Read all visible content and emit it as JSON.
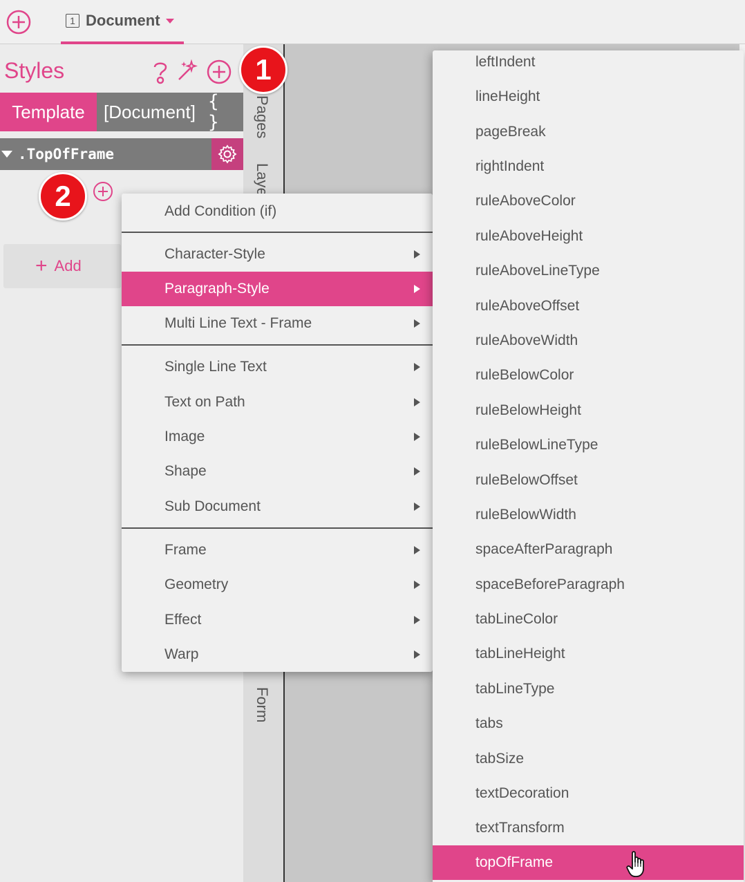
{
  "tabbar": {
    "new_icon": "plus-circle-icon",
    "document_tab": {
      "number": "1",
      "label": "Document"
    }
  },
  "styles_panel": {
    "title": "Styles",
    "header_icons": [
      "question-icon",
      "magic-wand-icon",
      "plus-circle-icon"
    ],
    "segments": {
      "template": "Template",
      "document": "[Document]",
      "braces": "{ }"
    },
    "rule_name": ".TopOfFrame",
    "add_button": "Add"
  },
  "side_tabs": [
    "Pages",
    "Laye",
    "Form"
  ],
  "badges": [
    "1",
    "2"
  ],
  "context_menu": {
    "items": [
      {
        "label": "Add Condition (if)",
        "submenu": false
      },
      {
        "label": "Character-Style",
        "submenu": true
      },
      {
        "label": "Paragraph-Style",
        "submenu": true,
        "active": true
      },
      {
        "label": "Multi Line Text - Frame",
        "submenu": true
      },
      {
        "label": "Single Line Text",
        "submenu": true
      },
      {
        "label": "Text on Path",
        "submenu": true
      },
      {
        "label": "Image",
        "submenu": true
      },
      {
        "label": "Shape",
        "submenu": true
      },
      {
        "label": "Sub Document",
        "submenu": true
      },
      {
        "label": "Frame",
        "submenu": true
      },
      {
        "label": "Geometry",
        "submenu": true
      },
      {
        "label": "Effect",
        "submenu": true
      },
      {
        "label": "Warp",
        "submenu": true
      }
    ]
  },
  "submenu": {
    "items": [
      "leftIndent",
      "lineHeight",
      "pageBreak",
      "rightIndent",
      "ruleAboveColor",
      "ruleAboveHeight",
      "ruleAboveLineType",
      "ruleAboveOffset",
      "ruleAboveWidth",
      "ruleBelowColor",
      "ruleBelowHeight",
      "ruleBelowLineType",
      "ruleBelowOffset",
      "ruleBelowWidth",
      "spaceAfterParagraph",
      "spaceBeforeParagraph",
      "tabLineColor",
      "tabLineHeight",
      "tabLineType",
      "tabs",
      "tabSize",
      "textDecoration",
      "textTransform",
      "topOfFrame"
    ],
    "active": "topOfFrame"
  },
  "colors": {
    "accent": "#e0458a",
    "badge": "#e8141b",
    "panel_grey": "#7b7b7b"
  }
}
